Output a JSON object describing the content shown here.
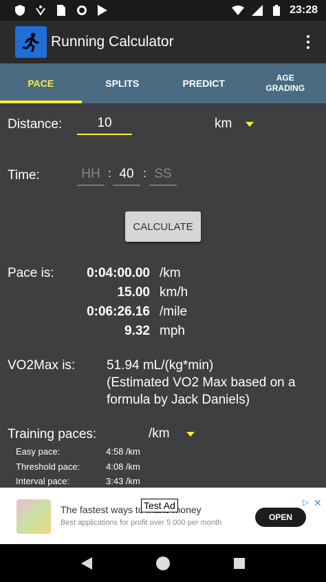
{
  "status_bar": {
    "time": "23:28"
  },
  "app_bar": {
    "title": "Running Calculator"
  },
  "tabs": [
    {
      "label": "PACE",
      "active": true
    },
    {
      "label": "SPLITS",
      "active": false
    },
    {
      "label": "PREDICT",
      "active": false
    },
    {
      "label_line1": "AGE",
      "label_line2": "GRADING",
      "active": false
    }
  ],
  "form": {
    "distance_label": "Distance:",
    "distance_value": "10",
    "distance_unit": "km",
    "time_label": "Time:",
    "hh_placeholder": "HH",
    "mm_value": "40",
    "ss_placeholder": "SS",
    "separator": ":",
    "calculate_label": "CALCULATE"
  },
  "results": {
    "pace_label": "Pace is:",
    "rows": [
      {
        "value": "0:04:00.00",
        "unit": "/km"
      },
      {
        "value": "15.00",
        "unit": "km/h"
      },
      {
        "value": "0:06:26.16",
        "unit": "/mile"
      },
      {
        "value": "9.32",
        "unit": "mph"
      }
    ],
    "vo2_label": "VO2Max is:",
    "vo2_value": "51.94 mL/(kg*min)",
    "vo2_note": "(Estimated VO2 Max based on a formula by Jack Daniels)"
  },
  "training": {
    "label": "Training paces:",
    "unit": "/km",
    "rows": [
      {
        "name": "Easy pace:",
        "value": "4:58 /km"
      },
      {
        "name": "Threshold pace:",
        "value": "4:08 /km"
      },
      {
        "name": "Interval pace:",
        "value": "3:43 /km"
      }
    ]
  },
  "ad": {
    "label": "Test Ad",
    "title": "The fastest ways to make money",
    "subtitle": "Best applications for profit over 5 000 per month",
    "open_label": "OPEN",
    "close_symbol": "✕"
  },
  "colors": {
    "accent": "#ffee33",
    "tab_bar": "#4a6b82",
    "content_bg": "#3d3f41",
    "app_bar": "#2b2b2b",
    "logo_bg": "#1f6fd6"
  }
}
